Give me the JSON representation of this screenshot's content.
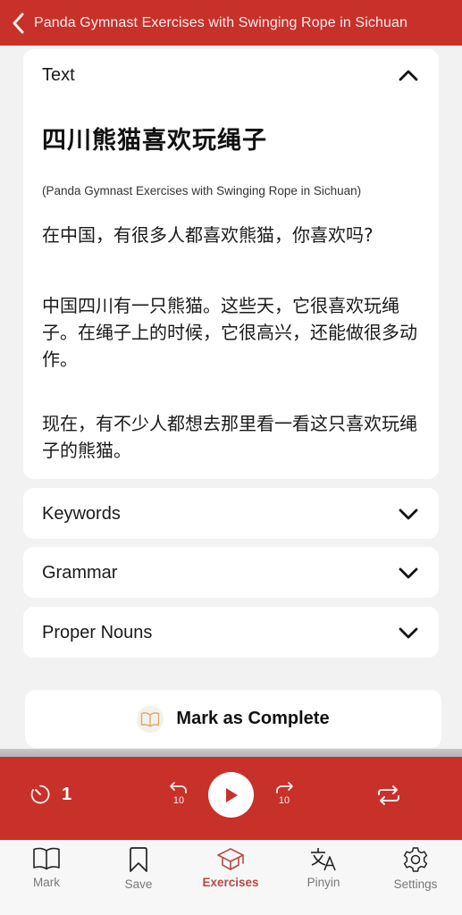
{
  "header": {
    "title": "Panda Gymnast Exercises with Swinging Rope in Sichuan",
    "back_icon": "chevron-left-icon"
  },
  "text_section": {
    "label": "Text",
    "expanded": true,
    "toggle_icon": "chevron-up-icon",
    "chinese_title": "四川熊猫喜欢玩绳子",
    "english_subtitle": "(Panda Gymnast Exercises with Swinging Rope in Sichuan)",
    "paragraphs": [
      "在中国，有很多人都喜欢熊猫，你喜欢吗?",
      "中国四川有一只熊猫。这些天，它很喜欢玩绳子。在绳子上的时候，它很高兴，还能做很多动作。",
      "现在，有不少人都想去那里看一看这只喜欢玩绳子的熊猫。"
    ]
  },
  "sections": [
    {
      "label": "Keywords",
      "expanded": false,
      "toggle_icon": "chevron-down-icon"
    },
    {
      "label": "Grammar",
      "expanded": false,
      "toggle_icon": "chevron-down-icon"
    },
    {
      "label": "Proper Nouns",
      "expanded": false,
      "toggle_icon": "chevron-down-icon"
    }
  ],
  "mark_complete": {
    "label": "Mark as Complete",
    "icon": "open-book-icon",
    "icon_color": "#e0a868"
  },
  "player": {
    "speed_icon": "timer-icon",
    "speed_value": "1",
    "skip_back_seconds": "10",
    "skip_forward_seconds": "10",
    "play_icon": "play-icon",
    "repeat_icon": "repeat-icon",
    "background_color": "#c8302a"
  },
  "tabbar": {
    "active": "Exercises",
    "active_color": "#b84a45",
    "items": [
      {
        "label": "Mark",
        "icon": "open-book-icon"
      },
      {
        "label": "Save",
        "icon": "bookmark-icon"
      },
      {
        "label": "Exercises",
        "icon": "graduation-cap-icon"
      },
      {
        "label": "Pinyin",
        "icon": "translate-icon"
      },
      {
        "label": "Settings",
        "icon": "gear-icon"
      }
    ]
  },
  "colors": {
    "brand_red": "#c8302a",
    "page_background": "#f2f2f2",
    "card_background": "#ffffff"
  }
}
